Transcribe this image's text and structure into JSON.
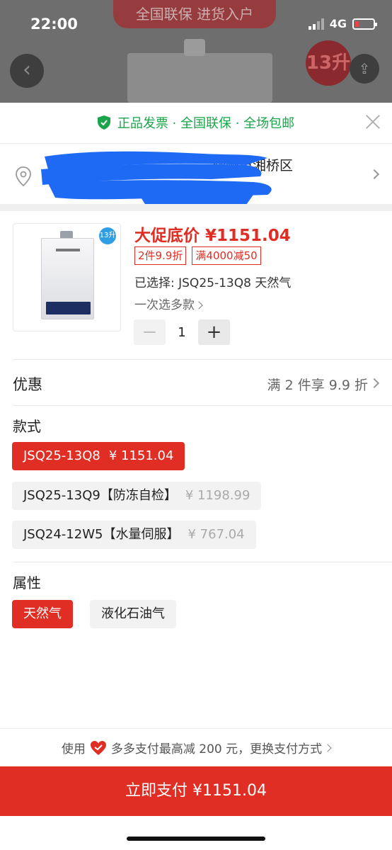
{
  "status_bar": {
    "time": "22:00",
    "network": "4G"
  },
  "background": {
    "banner_text": "全国联保  进货入户",
    "badge": "13升"
  },
  "guarantee": {
    "text": "正品发票 · 全国联保 · 全场包邮"
  },
  "address": {
    "visible_text": "潮州市湘桥区"
  },
  "product": {
    "image_badge": "13升",
    "price": "大促底价 ¥1151.04",
    "tags": [
      "2件9.9折",
      "满4000减50"
    ],
    "selected": "已选择: JSQ25-13Q8 天然气",
    "multi_select": "一次选多款",
    "quantity": "1",
    "minus": "−",
    "plus": "+"
  },
  "promo": {
    "label": "优惠",
    "value": "满 2 件享 9.9 折"
  },
  "styles": {
    "title": "款式",
    "options": [
      {
        "name": "JSQ25-13Q8",
        "price": "¥ 1151.04",
        "active": true
      },
      {
        "name": "JSQ25-13Q9【防冻自检】",
        "price": "¥ 1198.99",
        "active": false
      },
      {
        "name": "JSQ24-12W5【水量伺服】",
        "price": "¥ 767.04",
        "active": false
      }
    ]
  },
  "attributes": {
    "title": "属性",
    "options": [
      {
        "name": "天然气",
        "active": true
      },
      {
        "name": "液化石油气",
        "active": false
      }
    ]
  },
  "payment": {
    "tip_prefix": "使用",
    "tip_text": "多多支付最高减 200 元，更换支付方式",
    "button": "立即支付 ¥1151.04"
  },
  "colors": {
    "accent": "#e02e24",
    "guarantee_green": "#1aa54a",
    "badge_blue": "#2f9ee3"
  }
}
